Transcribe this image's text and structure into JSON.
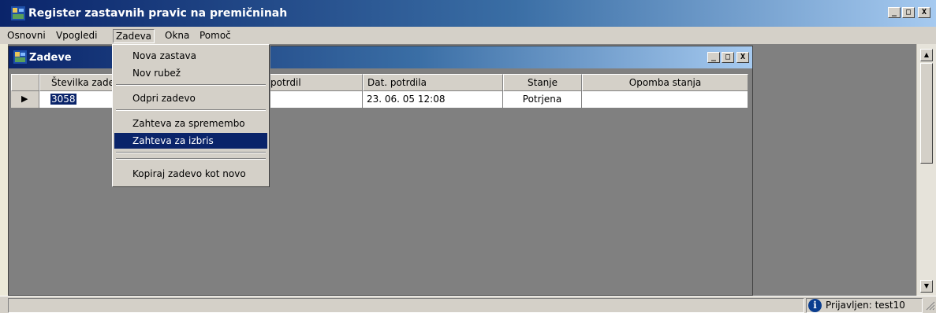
{
  "window": {
    "title": "Register zastavnih pravic na premičninah",
    "controls": {
      "minimize": "_",
      "maximize": "□",
      "close": "X"
    }
  },
  "menubar": {
    "items": [
      {
        "label": "Osnovni"
      },
      {
        "label": "Vpogledi"
      },
      {
        "label": "Zadeva",
        "open": true
      },
      {
        "label": "Okna"
      },
      {
        "label": "Pomoč"
      }
    ]
  },
  "dropdown": {
    "items": [
      {
        "label": "Nova zastava"
      },
      {
        "label": "Nov rubež"
      },
      {
        "label": "Odpri zadevo"
      },
      {
        "label": "Zahteva za spremembo"
      },
      {
        "label": "Zahteva za izbris",
        "highlighted": true
      },
      {
        "label": "Kopiraj zadevo kot novo"
      }
    ]
  },
  "child_window": {
    "title": "Zadeve",
    "controls": {
      "minimize": "_",
      "maximize": "□",
      "close": "X"
    }
  },
  "grid": {
    "columns": [
      "Številka zade",
      "potrdil",
      "Dat. potrdila",
      "Stanje",
      "Opomba stanja"
    ],
    "rows": [
      {
        "marker": "▶",
        "number": "3058",
        "confirmed_by": "",
        "date": "23. 06. 05 12:08",
        "status": "Potrjena",
        "note": ""
      }
    ]
  },
  "statusbar": {
    "user_text": "Prijavljen: test10"
  },
  "colors": {
    "titlebar_start": "#0a246a",
    "titlebar_end": "#a6caf0",
    "highlight": "#0a246a",
    "chrome": "#d4d0c8",
    "workspace": "#808080"
  },
  "icons": [
    "app-icon",
    "info-icon",
    "row-selector-arrow-icon",
    "scroll-up-arrow-icon",
    "scroll-down-arrow-icon",
    "size-grip-icon"
  ]
}
